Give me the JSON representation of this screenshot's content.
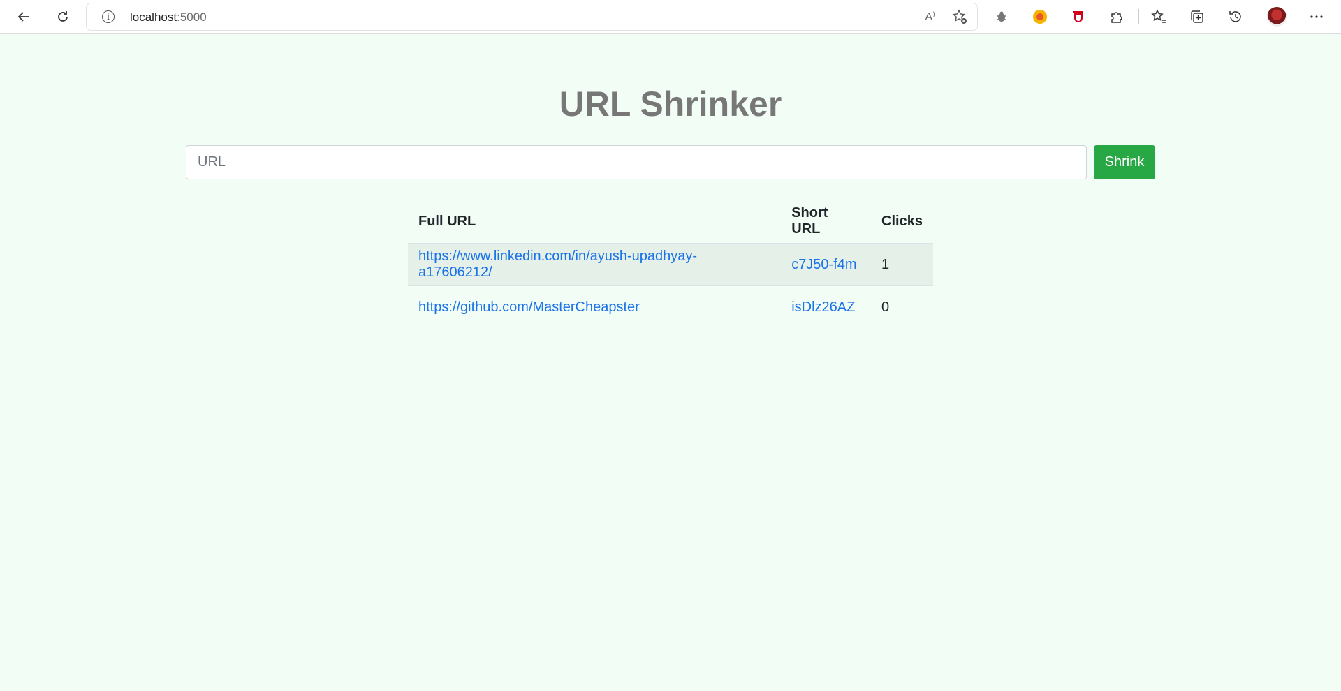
{
  "browser": {
    "address": {
      "host": "localhost",
      "port": ":5000"
    },
    "read_aloud": "A⁾"
  },
  "page": {
    "title": "URL Shrinker",
    "input": {
      "placeholder": "URL",
      "value": ""
    },
    "shrink_label": "Shrink"
  },
  "table": {
    "headers": {
      "full": "Full URL",
      "short": "Short URL",
      "clicks": "Clicks"
    },
    "rows": [
      {
        "full": "https://www.linkedin.com/in/ayush-upadhyay-a17606212/",
        "short": "c7J50-f4m",
        "clicks": "1"
      },
      {
        "full": "https://github.com/MasterCheapster",
        "short": "isDlz26AZ",
        "clicks": "0"
      }
    ]
  },
  "colors": {
    "accent": "#28a745",
    "link": "#1a73e8",
    "background": "#f2fdf6"
  }
}
